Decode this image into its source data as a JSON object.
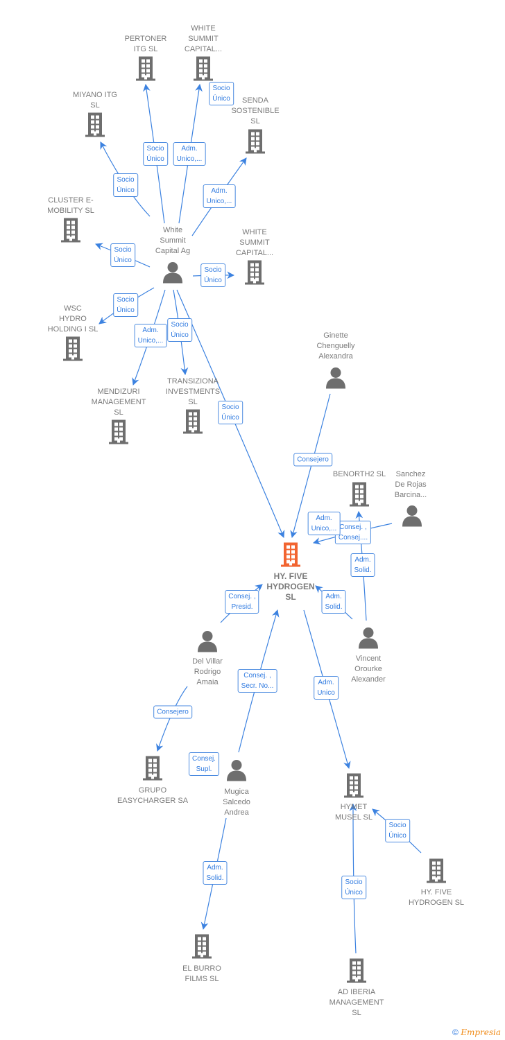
{
  "colors": {
    "edge": "#3c82e0",
    "node": "#6e6e6e",
    "focus": "#f26430"
  },
  "nodes": [
    {
      "id": "hub",
      "type": "person",
      "lines": [
        "White",
        "Summit",
        "Capital Ag"
      ]
    },
    {
      "id": "pertoner",
      "type": "company",
      "lines": [
        "PERTONER",
        "ITG  SL"
      ]
    },
    {
      "id": "wsc1",
      "type": "company",
      "lines": [
        "WHITE",
        "SUMMIT",
        "CAPITAL..."
      ]
    },
    {
      "id": "miyano",
      "type": "company",
      "lines": [
        "MIYANO ITG",
        "SL"
      ]
    },
    {
      "id": "senda",
      "type": "company",
      "lines": [
        "SENDA",
        "SOSTENIBLE",
        "SL"
      ]
    },
    {
      "id": "cluster",
      "type": "company",
      "lines": [
        "CLUSTER E-",
        "MOBILITY  SL"
      ]
    },
    {
      "id": "wsc2",
      "type": "company",
      "lines": [
        "WHITE",
        "SUMMIT",
        "CAPITAL..."
      ]
    },
    {
      "id": "wschydro",
      "type": "company",
      "lines": [
        "WSC",
        "HYDRO",
        "HOLDING I  SL"
      ]
    },
    {
      "id": "mendizuri",
      "type": "company",
      "lines": [
        "MENDIZURI",
        "MANAGEMENT",
        "SL"
      ]
    },
    {
      "id": "transiziona",
      "type": "company",
      "lines": [
        "TRANSIZIONA",
        "INVESTMENTS",
        "SL"
      ]
    },
    {
      "id": "ginette",
      "type": "person",
      "lines": [
        "Ginette",
        "Chenguelly",
        "Alexandra"
      ]
    },
    {
      "id": "benorth2",
      "type": "company",
      "lines": [
        "BENORTH2  SL"
      ]
    },
    {
      "id": "sanchez",
      "type": "person",
      "lines": [
        "Sanchez",
        "De Rojas",
        "Barcina..."
      ]
    },
    {
      "id": "main",
      "type": "focus",
      "lines": [
        "HY. FIVE",
        "HYDROGEN",
        "SL"
      ]
    },
    {
      "id": "vincent",
      "type": "person",
      "lines": [
        "Vincent",
        "Orourke",
        "Alexander"
      ]
    },
    {
      "id": "delvillar",
      "type": "person",
      "lines": [
        "Del Villar",
        "Rodrigo",
        "Amaia"
      ]
    },
    {
      "id": "grupo",
      "type": "company",
      "lines": [
        "GRUPO",
        "EASYCHARGER SA"
      ]
    },
    {
      "id": "mugica",
      "type": "person",
      "lines": [
        "Mugica",
        "Salcedo",
        "Andrea"
      ]
    },
    {
      "id": "hymet",
      "type": "company",
      "lines": [
        "HYMET",
        "MUSEL  SL"
      ]
    },
    {
      "id": "hyfive2",
      "type": "company",
      "lines": [
        "HY.  FIVE",
        "HYDROGEN  SL"
      ]
    },
    {
      "id": "elburro",
      "type": "company",
      "lines": [
        "EL BURRO",
        "FILMS  SL"
      ]
    },
    {
      "id": "adiberia",
      "type": "company",
      "lines": [
        "AD IBERIA",
        "MANAGEMENT",
        "SL"
      ]
    }
  ],
  "edges": [
    {
      "from": "hub",
      "to": "pertoner",
      "label": [
        "Socio",
        "Único"
      ]
    },
    {
      "from": "hub",
      "to": "wsc1",
      "label": [
        "Adm.",
        "Unico,..."
      ]
    },
    {
      "from": "hub",
      "to": "wsc1",
      "label": [
        "Socio",
        "Único"
      ]
    },
    {
      "from": "hub",
      "to": "miyano",
      "label": [
        "Socio",
        "Único"
      ]
    },
    {
      "from": "hub",
      "to": "senda",
      "label": [
        "Adm.",
        "Unico,..."
      ]
    },
    {
      "from": "hub",
      "to": "cluster",
      "label": [
        "Socio",
        "Único"
      ]
    },
    {
      "from": "hub",
      "to": "wsc2",
      "label": [
        "Socio",
        "Único"
      ]
    },
    {
      "from": "hub",
      "to": "wschydro",
      "label": [
        "Socio",
        "Único"
      ]
    },
    {
      "from": "hub",
      "to": "mendizuri",
      "label": [
        "Adm.",
        "Unico,..."
      ]
    },
    {
      "from": "hub",
      "to": "transiziona",
      "label": [
        "Socio",
        "Único"
      ]
    },
    {
      "from": "hub",
      "to": "main",
      "label": [
        "Socio",
        "Único"
      ]
    },
    {
      "from": "ginette",
      "to": "main",
      "label": [
        "Consejero"
      ]
    },
    {
      "from": "sanchez",
      "to": "main",
      "label": [
        "Consej. ,",
        "Consej...."
      ]
    },
    {
      "from": "sanchez",
      "to": "main",
      "label": [
        "Adm.",
        "Unico,..."
      ]
    },
    {
      "from": "vincent",
      "to": "benorth2",
      "label": [
        "Adm.",
        "Solid."
      ]
    },
    {
      "from": "vincent",
      "to": "main",
      "label": [
        "Adm.",
        "Solid."
      ]
    },
    {
      "from": "delvillar",
      "to": "main",
      "label": [
        "Consej. ,",
        "Presid."
      ]
    },
    {
      "from": "mugica",
      "to": "main",
      "label": [
        "Consej. ,",
        "Secr. No..."
      ]
    },
    {
      "from": "mugica",
      "to": "main",
      "label": [
        "Consej.",
        "Supl."
      ]
    },
    {
      "from": "main",
      "to": "hymet",
      "label": [
        "Adm.",
        "Unico"
      ]
    },
    {
      "from": "delvillar",
      "to": "grupo",
      "label": [
        "Consejero"
      ]
    },
    {
      "from": "mugica",
      "to": "elburro",
      "label": [
        "Adm.",
        "Solid."
      ]
    },
    {
      "from": "hyfive2",
      "to": "hymet",
      "label": [
        "Socio",
        "Único"
      ]
    },
    {
      "from": "adiberia",
      "to": "hymet",
      "label": [
        "Socio",
        "Único"
      ]
    }
  ],
  "footer": {
    "copyright": "©",
    "brand": "Empresia"
  }
}
